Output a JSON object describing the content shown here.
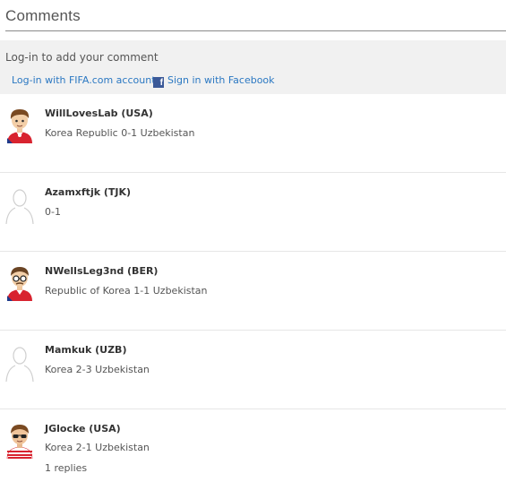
{
  "header": {
    "title": "Comments"
  },
  "login": {
    "prompt": "Log-in to add your comment",
    "fifa_link": "Log-in with FIFA.com account",
    "facebook_link": "Sign in with Facebook"
  },
  "comments": [
    {
      "user": "WillLovesLab (USA)",
      "text": "Korea Republic 0-1 Uzbekistan",
      "avatar": "avatar-brown-hair-red-shirt"
    },
    {
      "user": "Azamxftjk (TJK)",
      "text": "0-1",
      "avatar": "avatar-placeholder-outline"
    },
    {
      "user": "NWellsLeg3nd (BER)",
      "text": "Republic of Korea 1-1 Uzbekistan",
      "avatar": "avatar-glasses-red-shirt"
    },
    {
      "user": "Mamkuk (UZB)",
      "text": "Korea 2-3 Uzbekistan",
      "avatar": "avatar-placeholder-outline"
    },
    {
      "user": "JGlocke (USA)",
      "text": "Korea 2-1 Uzbekistan",
      "avatar": "avatar-sunglasses-striped-shirt",
      "replies": "1 replies"
    }
  ]
}
